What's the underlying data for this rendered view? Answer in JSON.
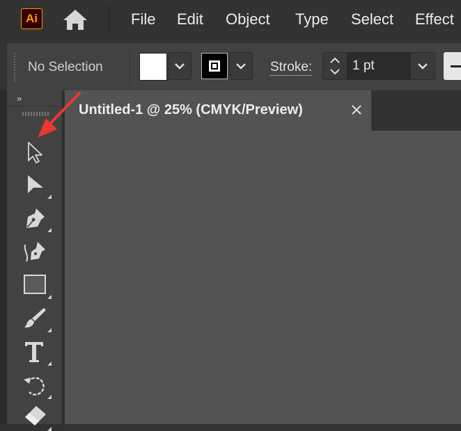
{
  "app": {
    "logo_text": "Ai",
    "accent": "#ff9a00",
    "logo_bg": "#330000"
  },
  "menubar": {
    "home_icon": "home-icon",
    "items": [
      "File",
      "Edit",
      "Object",
      "Type",
      "Select",
      "Effect"
    ]
  },
  "controlbar": {
    "selection_status": "No Selection",
    "fill_color": "#ffffff",
    "stroke_label": "Stroke:",
    "stroke_value": "1 pt"
  },
  "document": {
    "tab_title": "Untitled-1 @ 25% (CMYK/Preview)",
    "close_icon": "close-icon"
  },
  "tools": {
    "collapse_label": "»",
    "items": [
      {
        "name": "selection-tool",
        "icon": "selection-arrow-icon"
      },
      {
        "name": "direct-selection-tool",
        "icon": "direct-selection-arrow-icon"
      },
      {
        "name": "pen-tool",
        "icon": "pen-icon"
      },
      {
        "name": "curvature-tool",
        "icon": "curvature-pen-icon"
      },
      {
        "name": "rectangle-tool",
        "icon": "rectangle-icon"
      },
      {
        "name": "paintbrush-tool",
        "icon": "paintbrush-icon"
      },
      {
        "name": "type-tool",
        "icon": "type-icon"
      },
      {
        "name": "rotate-tool",
        "icon": "rotate-icon"
      },
      {
        "name": "eraser-tool",
        "icon": "eraser-icon"
      }
    ]
  },
  "annotation": {
    "arrow_color": "#e8392f"
  }
}
